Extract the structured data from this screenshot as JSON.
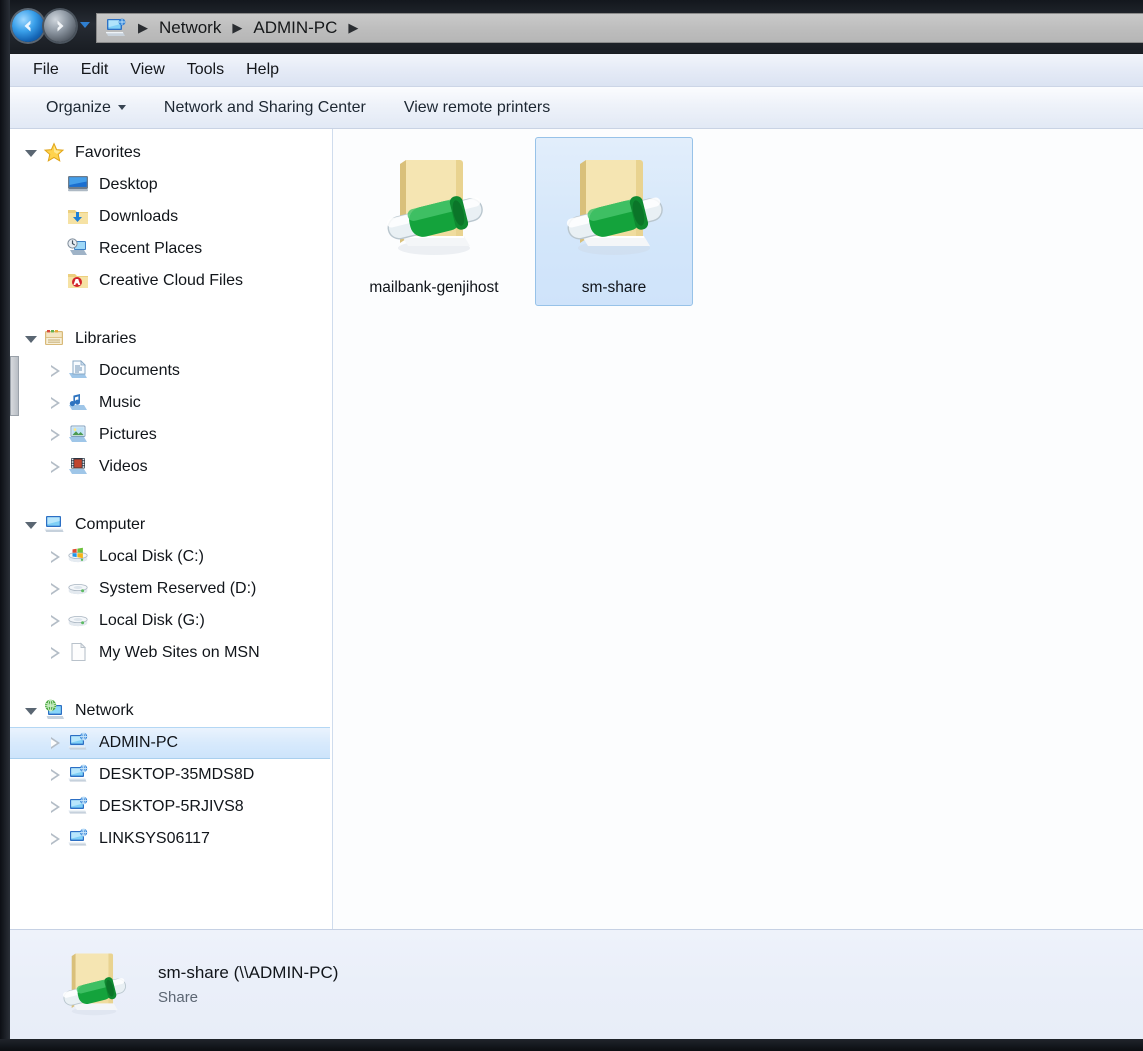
{
  "window": {
    "title_icon": "network-computer-icon"
  },
  "navigation": {
    "back_label": "Back",
    "forward_label": "Forward",
    "recent_pages_label": "Recent Pages",
    "breadcrumb": [
      "Network",
      "ADMIN-PC"
    ]
  },
  "menubar": {
    "items": [
      {
        "label": "File"
      },
      {
        "label": "Edit"
      },
      {
        "label": "View"
      },
      {
        "label": "Tools"
      },
      {
        "label": "Help"
      }
    ]
  },
  "commandbar": {
    "items": [
      {
        "label": "Organize",
        "has_caret": true
      },
      {
        "label": "Network and Sharing Center",
        "has_caret": false
      },
      {
        "label": "View remote printers",
        "has_caret": false
      }
    ]
  },
  "sidebar": {
    "groups": [
      {
        "header": {
          "label": "Favorites",
          "icon": "star-icon",
          "expanded": true
        },
        "items": [
          {
            "label": "Desktop",
            "icon": "desktop-icon",
            "twisty": false
          },
          {
            "label": "Downloads",
            "icon": "downloads-folder-icon",
            "twisty": false
          },
          {
            "label": "Recent Places",
            "icon": "recent-places-icon",
            "twisty": false
          },
          {
            "label": "Creative Cloud Files",
            "icon": "creative-cloud-folder-icon",
            "twisty": false
          }
        ]
      },
      {
        "header": {
          "label": "Libraries",
          "icon": "libraries-icon",
          "expanded": true
        },
        "items": [
          {
            "label": "Documents",
            "icon": "documents-library-icon",
            "twisty": true
          },
          {
            "label": "Music",
            "icon": "music-library-icon",
            "twisty": true
          },
          {
            "label": "Pictures",
            "icon": "pictures-library-icon",
            "twisty": true
          },
          {
            "label": "Videos",
            "icon": "videos-library-icon",
            "twisty": true
          }
        ]
      },
      {
        "header": {
          "label": "Computer",
          "icon": "computer-icon",
          "expanded": true
        },
        "items": [
          {
            "label": "Local Disk (C:)",
            "icon": "windows-drive-icon",
            "twisty": true
          },
          {
            "label": "System Reserved (D:)",
            "icon": "drive-icon",
            "twisty": true
          },
          {
            "label": "Local Disk (G:)",
            "icon": "drive-icon",
            "twisty": true
          },
          {
            "label": "My Web Sites on MSN",
            "icon": "page-icon",
            "twisty": true
          }
        ]
      },
      {
        "header": {
          "label": "Network",
          "icon": "network-globe-icon",
          "expanded": true
        },
        "items": [
          {
            "label": "ADMIN-PC",
            "icon": "network-computer-icon",
            "twisty": true,
            "selected": true
          },
          {
            "label": "DESKTOP-35MDS8D",
            "icon": "network-computer-icon",
            "twisty": true
          },
          {
            "label": "DESKTOP-5RJIVS8",
            "icon": "network-computer-icon",
            "twisty": true
          },
          {
            "label": "LINKSYS06117",
            "icon": "network-computer-icon",
            "twisty": true
          }
        ]
      }
    ]
  },
  "content": {
    "items": [
      {
        "name": "mailbank-genjihost",
        "icon": "shared-folder-icon",
        "selected": false
      },
      {
        "name": "sm-share",
        "icon": "shared-folder-icon",
        "selected": true
      }
    ]
  },
  "details": {
    "icon": "shared-folder-icon",
    "title": "sm-share (\\\\ADMIN-PC)",
    "subtitle": "Share"
  },
  "colors": {
    "selection_blue": "#cde4fb",
    "selection_border": "#97c2e8",
    "folder_yellow": "#f4dd96",
    "share_green": "#12a23c",
    "accent_link": "#1d2732"
  }
}
